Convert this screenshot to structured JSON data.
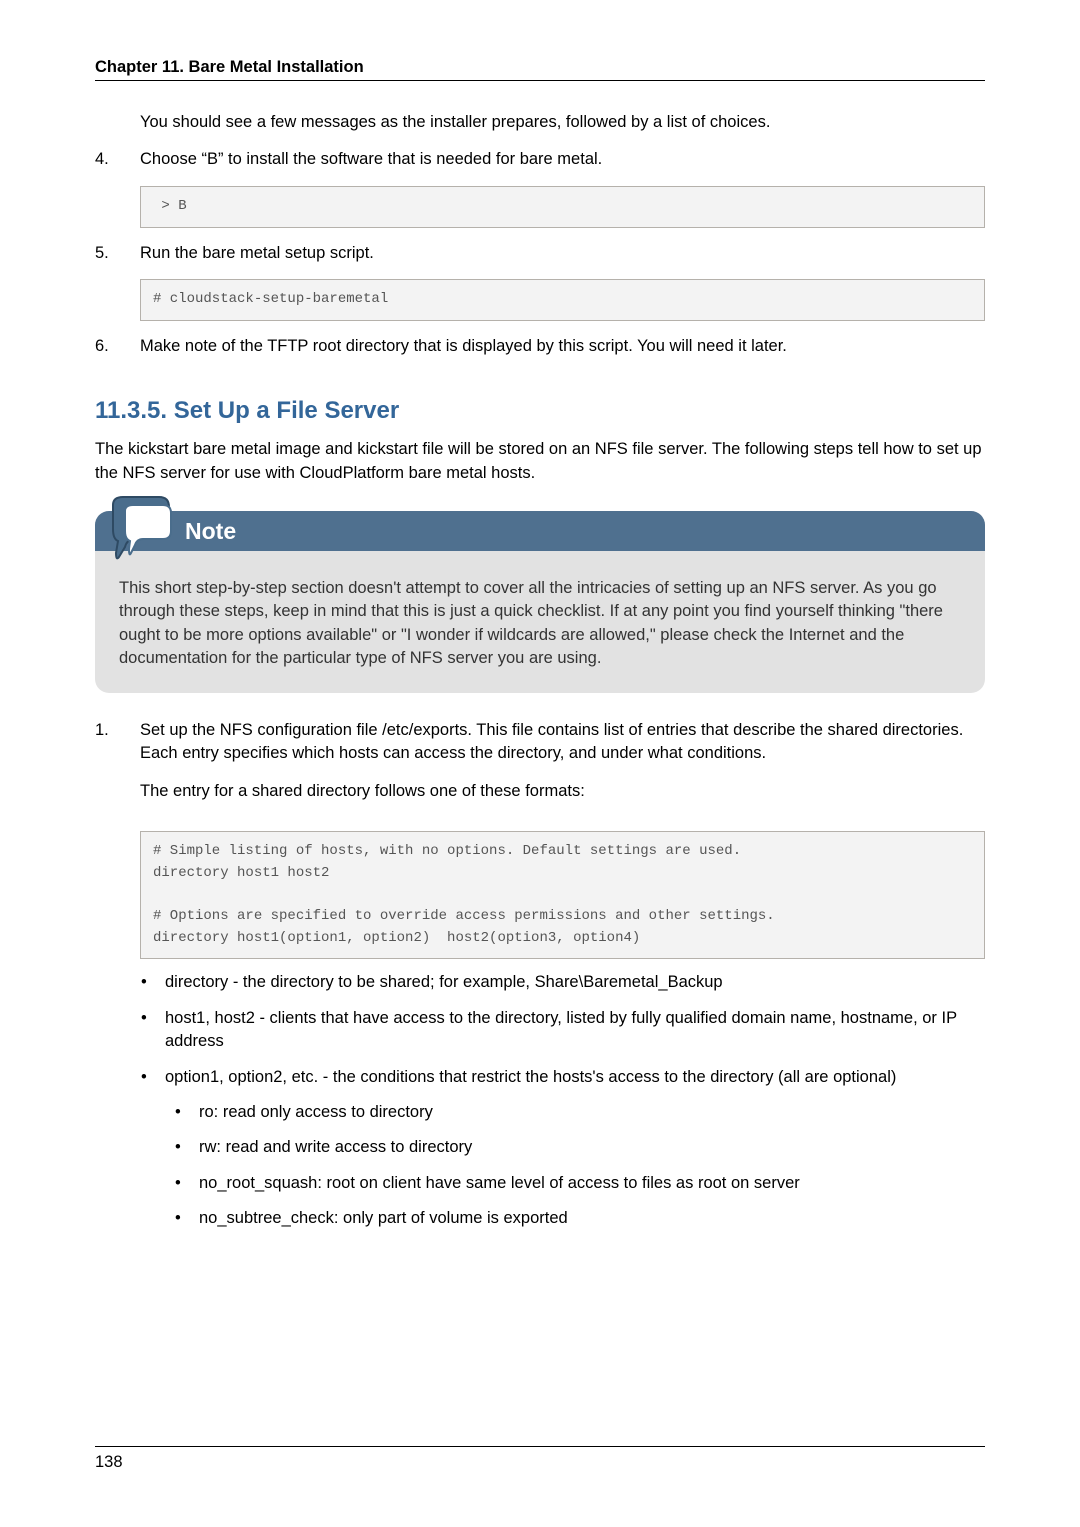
{
  "header": {
    "title": "Chapter 11. Bare Metal Installation"
  },
  "intro_line": "You should see a few messages as the installer prepares, followed by a list of choices.",
  "step4": {
    "num": "4.",
    "text": "Choose “B” to install the software that is needed for bare metal.",
    "code": " > B"
  },
  "step5": {
    "num": "5.",
    "text": "Run the bare metal setup script.",
    "code": "# cloudstack-setup-baremetal"
  },
  "step6": {
    "num": "6.",
    "text": "Make note of the TFTP root directory that is displayed by this script. You will need it later."
  },
  "section": {
    "heading": "11.3.5. Set Up a File Server",
    "para": "The kickstart bare metal image and kickstart file will be stored on an NFS file server. The following steps tell how to set up the NFS server for use with CloudPlatform bare metal hosts."
  },
  "note": {
    "label": "Note",
    "body": "This short step-by-step section doesn't attempt to cover all the intricacies of setting up an NFS server. As you go through these steps, keep in mind that this is just a quick checklist. If at any point you find yourself thinking \"there ought to be more options available\" or \"I wonder if wildcards are allowed,\" please check the Internet and the documentation for the particular type of NFS server you are using."
  },
  "step1": {
    "num": "1.",
    "text": "Set up the NFS configuration file /etc/exports. This file contains list of entries that describe the shared directories. Each entry specifies which hosts can access the directory, and under what conditions.",
    "text2": "The entry for a shared directory follows one of these formats:",
    "code": "# Simple listing of hosts, with no options. Default settings are used.\ndirectory host1 host2\n\n# Options are specified to override access permissions and other settings.\ndirectory host1(option1, option2)  host2(option3, option4)"
  },
  "bullets": {
    "b1": "directory - the directory to be shared; for example, Share\\Baremetal_Backup",
    "b2": "host1, host2 - clients that have access to the directory, listed by fully qualified domain name, hostname, or IP address",
    "b3": "option1, option2, etc. - the conditions that restrict the hosts's access to the directory (all are optional)",
    "s1": "ro: read only access to directory",
    "s2": "rw: read and write access to directory",
    "s3": "no_root_squash: root on client have same level of access to files as root on server",
    "s4": "no_subtree_check: only part of volume is exported"
  },
  "footer": {
    "page": "138"
  }
}
